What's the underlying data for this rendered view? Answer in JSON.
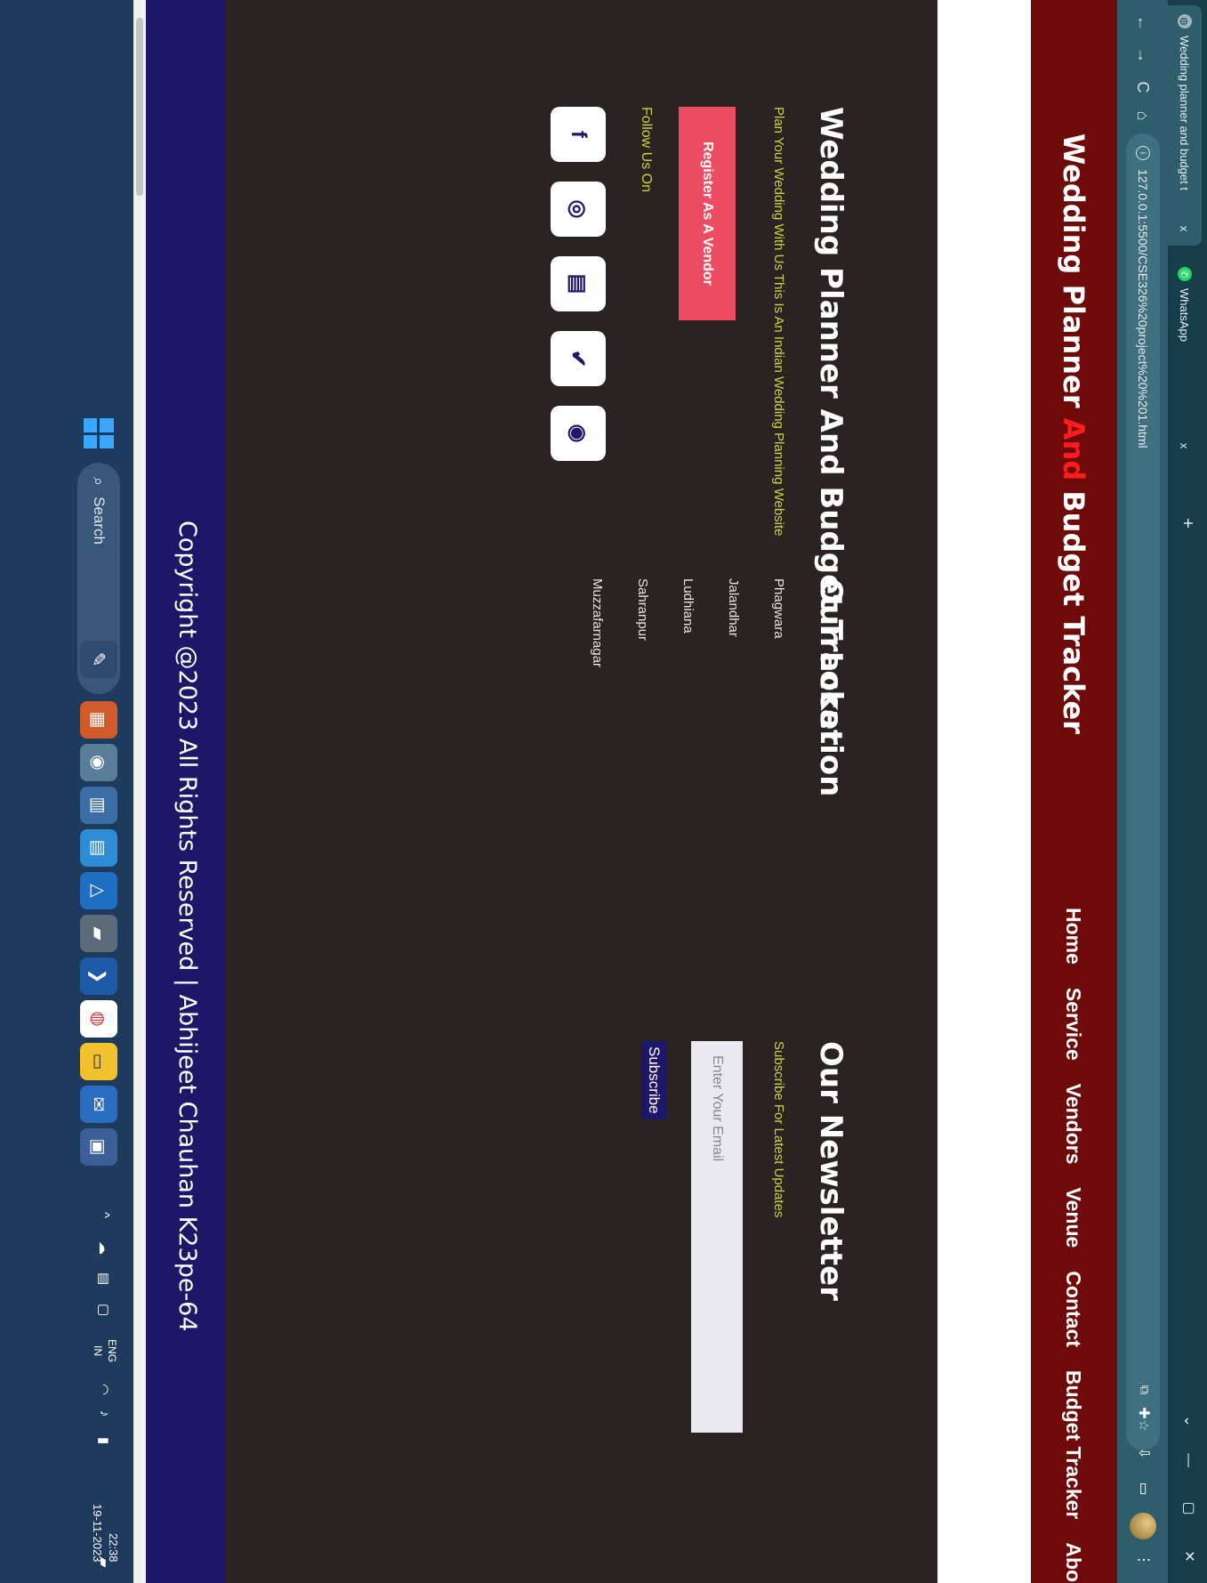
{
  "browser": {
    "tabs": [
      {
        "title": "Wedding planner and budget t",
        "active": true,
        "close": "x"
      },
      {
        "title": "WhatsApp",
        "active": false,
        "close": "x"
      }
    ],
    "new_tab": "+",
    "window_controls": {
      "minimize": "—",
      "maximize": "▢",
      "close": "✕"
    },
    "tab_list": "⌄",
    "address": "127.0.0.1:5500/CSE326%20project%20%201.html",
    "nav": {
      "back": "←",
      "forward": "→",
      "reload": "C",
      "home": "⌂"
    }
  },
  "site": {
    "brand_part1": "Wedding Planner ",
    "brand_accent": "And",
    "brand_part2": " Budget Tracker",
    "accent_color": "#ff1c1c",
    "nav": [
      "Home",
      "Service",
      "Vendors",
      "Venue",
      "Contact",
      "Budget Tracker",
      "About"
    ]
  },
  "footer": {
    "about": {
      "title": "Wedding Planner And Budget Tracker",
      "desc": "Plan Your Wedding With Us This Is An Indian Wedding Planning Website",
      "vendor_button": "Register As A Vendor",
      "follow": "Follow Us On",
      "socials": [
        {
          "name": "facebook-icon",
          "glyph": "f"
        },
        {
          "name": "instagram-icon",
          "glyph": "◎"
        },
        {
          "name": "news-icon",
          "glyph": "▤"
        },
        {
          "name": "twitter-icon",
          "glyph": "✔"
        },
        {
          "name": "whatsapp-icon",
          "glyph": "◉"
        }
      ]
    },
    "location": {
      "title": "Our Location",
      "items": [
        "Phagwara",
        "Jalandhar",
        "Ludhiana",
        "Sahranpur",
        "Muzzafarnagar"
      ]
    },
    "newsletter": {
      "title": "Our Newsletter",
      "desc": "Subscribe For Latest Updates",
      "email_placeholder": "Enter Your Email",
      "subscribe": "Subscribe"
    }
  },
  "copyright": "Copyright @2023 All Rights Reserved | Abhijeet Chauhan K23pe-64",
  "taskbar": {
    "search": "Search",
    "lang": "ENG",
    "region": "IN",
    "time": "22:38",
    "date": "19-11-2023"
  }
}
